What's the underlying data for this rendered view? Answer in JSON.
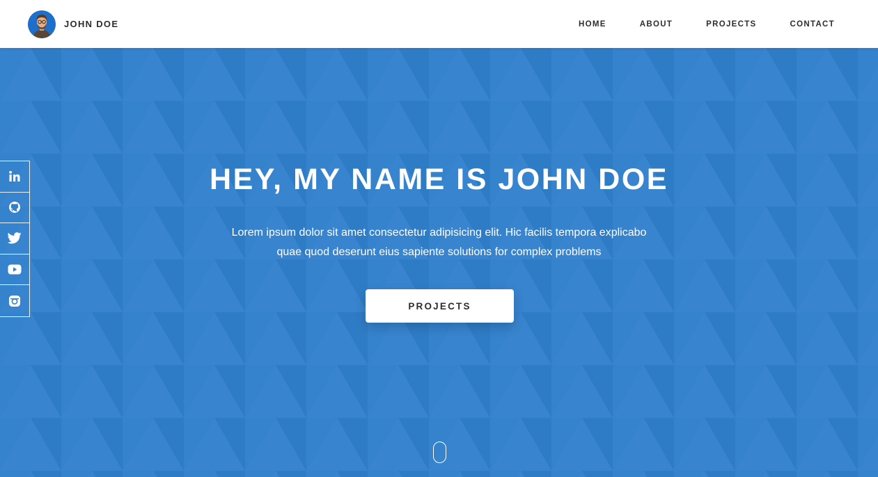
{
  "header": {
    "brand_name": "JOHN DOE",
    "nav": [
      "HOME",
      "ABOUT",
      "PROJECTS",
      "CONTACT"
    ]
  },
  "hero": {
    "title": "HEY, MY NAME IS JOHN DOE",
    "text_line1": "Lorem ipsum dolor sit amet consectetur adipisicing elit. Hic facilis tempora explicabo",
    "text_line2": "quae quod deserunt eius sapiente solutions for complex problems",
    "button_label": "PROJECTS"
  },
  "social": [
    "linkedin-icon",
    "github-icon",
    "twitter-icon",
    "youtube-icon",
    "instagram-icon"
  ],
  "colors": {
    "hero_bg": "#3180cc",
    "accent": "#1e6fc9",
    "text_dark": "#2d2d2d",
    "white": "#ffffff"
  }
}
